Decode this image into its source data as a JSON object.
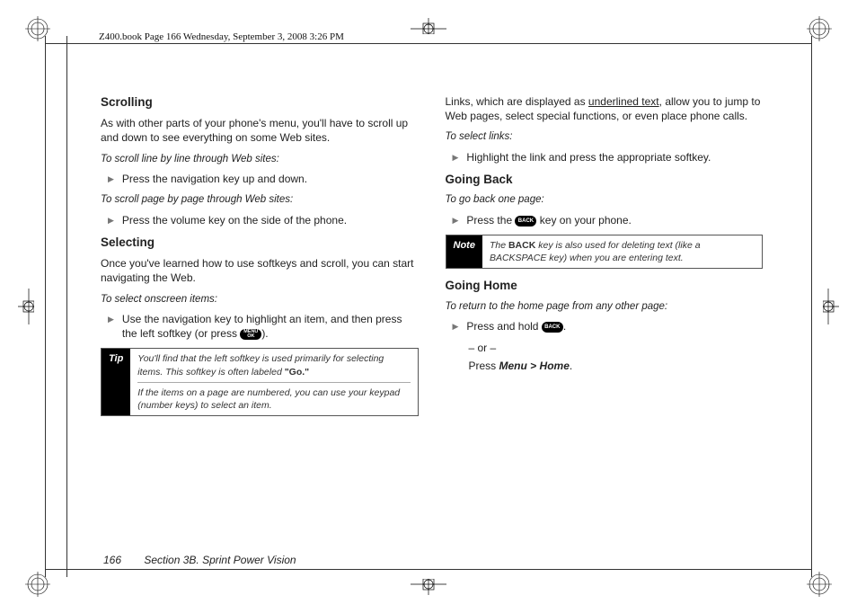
{
  "header": {
    "book_line": "Z400.book  Page 166  Wednesday, September 3, 2008  3:26 PM"
  },
  "footer": {
    "page_num": "166",
    "section": "Section 3B. Sprint Power Vision"
  },
  "col1": {
    "h_scroll": "Scrolling",
    "p_scroll": "As with other parts of your phone's menu, you'll have to scroll up and down to see everything on some Web sites.",
    "e_scroll_line": "To scroll line by line through Web sites:",
    "b_scroll_line": "Press the navigation key up and down.",
    "e_scroll_page": "To scroll page by page through Web sites:",
    "b_scroll_page": "Press the volume key on the side of the phone.",
    "h_select": "Selecting",
    "p_select": "Once you've learned how to use softkeys and scroll, you can start navigating the Web.",
    "e_select": "To select onscreen items:",
    "b_select_1a": "Use the navigation key to highlight an item, and then press the left softkey (or press ",
    "b_select_1b": ").",
    "tip_label": "Tip",
    "tip_row1_a": "You'll find that the left softkey is used primarily for selecting items. This softkey is often labeled ",
    "tip_row1_b": "\"Go.\"",
    "tip_row2": "If the items on a page are numbered, you can use your keypad (number keys) to select an item."
  },
  "col2": {
    "p_links_a": "Links, which are displayed as ",
    "p_links_ul": "underlined text",
    "p_links_b": ", allow you to jump to Web pages, select special functions, or even place phone calls.",
    "e_links": "To select links:",
    "b_links": "Highlight the link and press the appropriate softkey.",
    "h_back": "Going Back",
    "e_back": "To go back one page:",
    "b_back_a": "Press the ",
    "b_back_b": " key on your phone.",
    "note_label": "Note",
    "note_a": "The ",
    "note_key": "BACK",
    "note_b": " key is also used for deleting text (like a BACKSPACE key) when you are entering text.",
    "h_home": "Going Home",
    "e_home": "To return to the home page from any other page:",
    "b_home_a": "Press and hold ",
    "b_home_b": ".",
    "or": "– or –",
    "press_menu_a": "Press ",
    "press_menu_b": "Menu > Home",
    "press_menu_c": "."
  },
  "keys": {
    "menu_ok_1": "MENU",
    "menu_ok_2": "OK",
    "back": "BACK"
  }
}
